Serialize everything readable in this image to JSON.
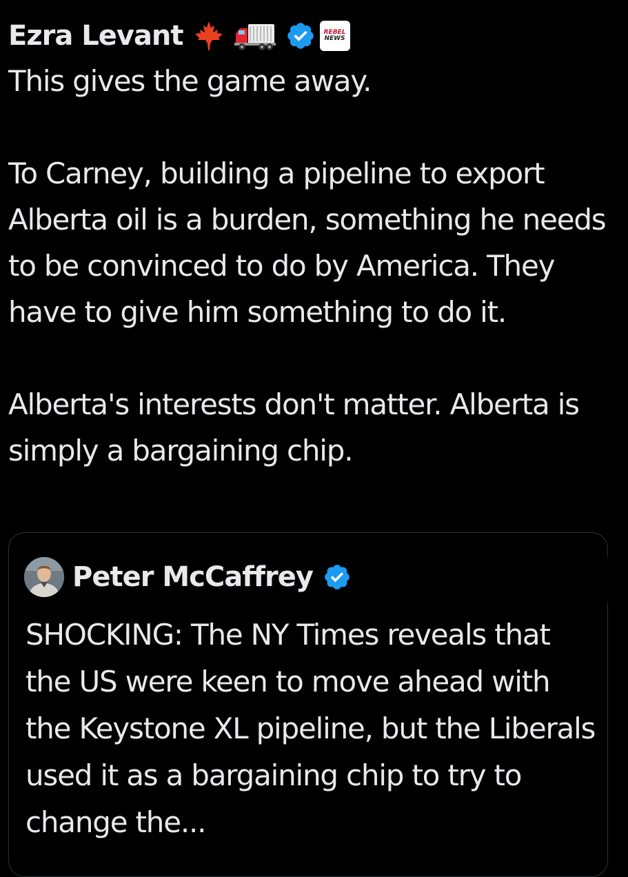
{
  "colors": {
    "background": "#000000",
    "text": "#e7e9ea",
    "verified_blue": "#1d9bf0",
    "card_border": "#2f3336"
  },
  "tweet": {
    "author_name": "Ezra Levant",
    "badges": [
      "maple-leaf-icon",
      "truck-icon",
      "verified-badge-icon",
      "rebel-news-affiliate-icon"
    ],
    "affiliate_badge_text_line1": "REBEL",
    "affiliate_badge_text_line2": "NEWS",
    "body": "This gives the game away.\n\nTo Carney, building a pipeline to export Alberta oil is a burden, something he needs to be convinced to do by America. They have to give him something to do it.\n\nAlberta's interests don't matter. Alberta is simply a bargaining chip."
  },
  "quoted_tweet": {
    "author_name": "Peter McCaffrey",
    "avatar": "avatar-photo",
    "badges": [
      "verified-badge-icon"
    ],
    "body": "SHOCKING: The NY Times reveals that the US were keen to move ahead with the Keystone XL pipeline, but the Liberals used it as a bargaining chip to try to change the..."
  }
}
